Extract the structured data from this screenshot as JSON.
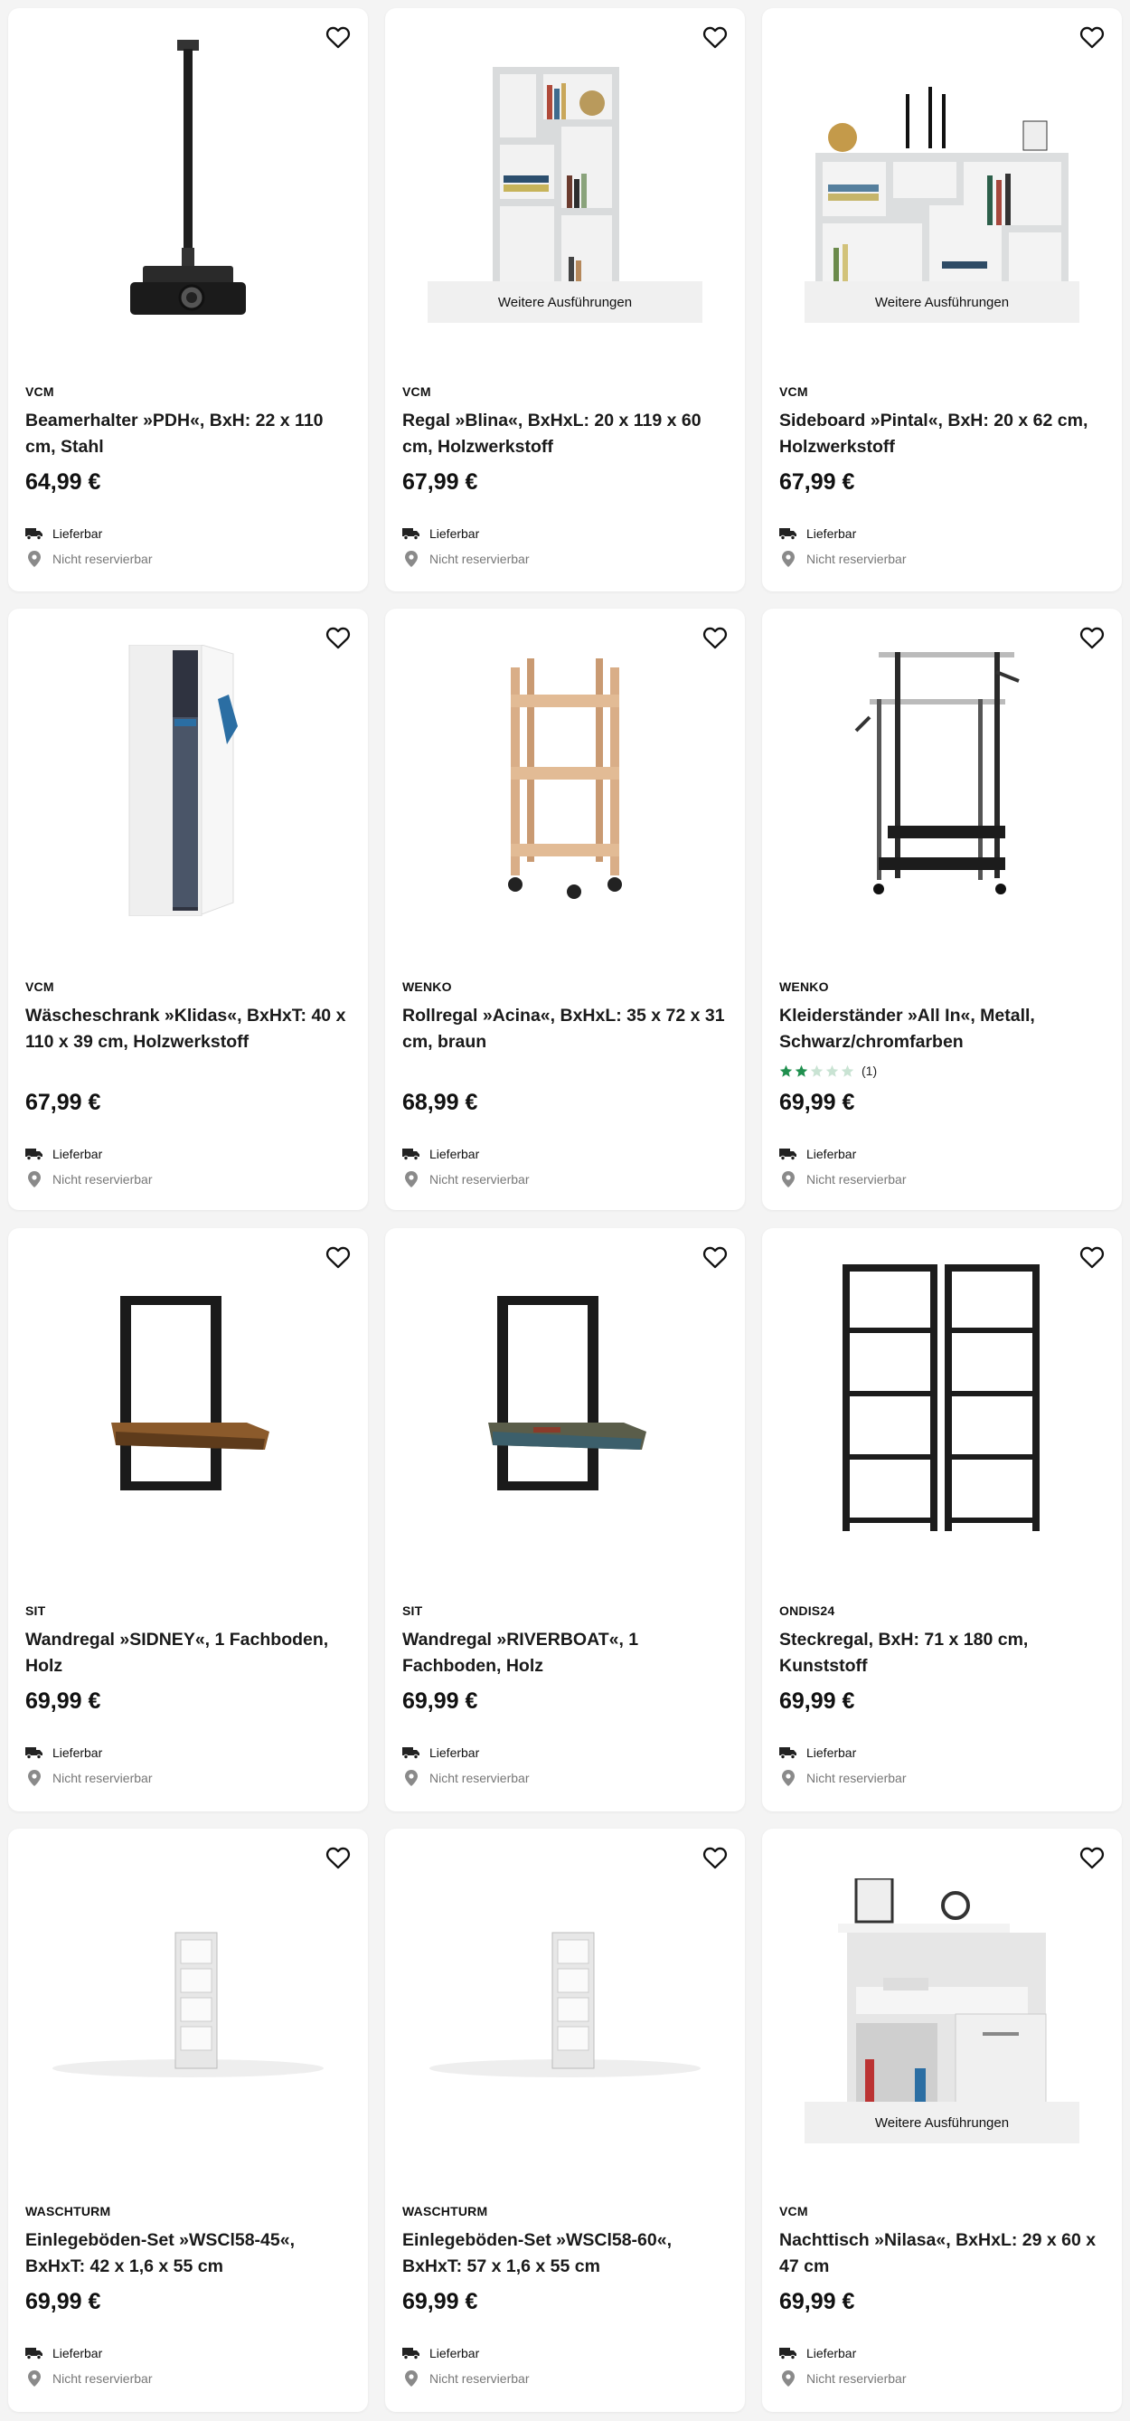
{
  "common": {
    "more_label": "Weitere Ausführungen",
    "delivery_label": "Lieferbar",
    "reserve_label": "Nicht reservierbar"
  },
  "colors": {
    "page_bg": "#f4f4f4",
    "card_bg": "#ffffff",
    "star_filled": "#1f8f4e",
    "star_empty": "#c9e3d3",
    "more_button_bg": "#f0f0f0"
  },
  "products": [
    {
      "brand": "VCM",
      "title": "Beamerhalter »PDH«, BxH: 22 x 110 cm, Stahl",
      "price": "64,99 €",
      "image": "projector-ceiling-mount",
      "more": false
    },
    {
      "brand": "VCM",
      "title": "Regal »Blina«, BxHxL: 20 x 119 x 60 cm, Holzwerkstoff",
      "price": "67,99 €",
      "image": "white-bookshelf",
      "more": true
    },
    {
      "brand": "VCM",
      "title": "Sideboard »Pintal«, BxH: 20 x 62 cm, Holzwerkstoff",
      "price": "67,99 €",
      "image": "white-sideboard",
      "more": true
    },
    {
      "brand": "VCM",
      "title": "Wäscheschrank »Klidas«, BxHxT: 40 x 110 x 39 cm, Holzwerkstoff",
      "price": "67,99 €",
      "image": "laundry-cabinet",
      "more": false
    },
    {
      "brand": "WENKO",
      "title": "Rollregal »Acina«, BxHxL: 35 x 72 x 31 cm, braun",
      "price": "68,99 €",
      "image": "wooden-trolley",
      "more": false
    },
    {
      "brand": "WENKO",
      "title": "Kleiderständer »All In«, Metall, Schwarz/chromfarben",
      "price": "69,99 €",
      "image": "clothes-rack",
      "more": false,
      "rating": {
        "stars": 2,
        "max": 5,
        "count": "(1)"
      }
    },
    {
      "brand": "SIT",
      "title": "Wandregal »SIDNEY«, 1 Fachboden, Holz",
      "price": "69,99 €",
      "image": "wall-shelf-wood",
      "more": false
    },
    {
      "brand": "SIT",
      "title": "Wandregal »RIVERBOAT«, 1 Fachboden, Holz",
      "price": "69,99 €",
      "image": "wall-shelf-riverboat",
      "more": false
    },
    {
      "brand": "ONDIS24",
      "title": "Steckregal, BxH: 71 x 180 cm, Kunststoff",
      "price": "69,99 €",
      "image": "plastic-shelving",
      "more": false
    },
    {
      "brand": "WASCHTURM",
      "title": "Einlegeböden-Set »WSCl58-45«, BxHxT: 42 x 1,6 x 55 cm",
      "price": "69,99 €",
      "image": "washer-tower-45",
      "more": false
    },
    {
      "brand": "WASCHTURM",
      "title": "Einlegeböden-Set »WSCl58-60«, BxHxT: 57 x 1,6 x 55 cm",
      "price": "69,99 €",
      "image": "washer-tower-60",
      "more": false
    },
    {
      "brand": "VCM",
      "title": "Nachttisch »Nilasa«, BxHxL: 29 x 60 x 47 cm",
      "price": "69,99 €",
      "image": "nightstand",
      "more": true
    }
  ]
}
